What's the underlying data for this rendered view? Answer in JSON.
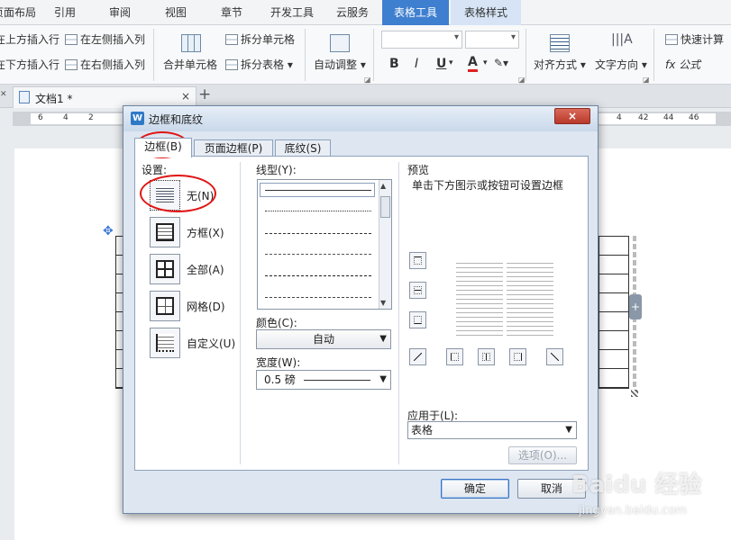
{
  "ribbon_tabs": [
    {
      "label": "页面布局"
    },
    {
      "label": "引用"
    },
    {
      "label": "审阅"
    },
    {
      "label": "视图"
    },
    {
      "label": "章节"
    },
    {
      "label": "开发工具"
    },
    {
      "label": "云服务"
    },
    {
      "label": "表格工具"
    },
    {
      "label": "表格样式"
    }
  ],
  "ribbon": {
    "insert_above": "在上方插入行",
    "insert_left": "在左侧插入列",
    "insert_below": "在下方插入行",
    "insert_right": "在右侧插入列",
    "merge_cells": "合并单元格",
    "split_cells": "拆分单元格",
    "split_table": "拆分表格",
    "auto_fit": "自动调整",
    "bold": "B",
    "italic": "I",
    "underline": "U",
    "font_color": "A",
    "align": "对齐方式",
    "text_direction": "文字方向",
    "quick_calc": "快速计算",
    "formula": "fx 公式"
  },
  "document_tab": {
    "label": "文档1 *",
    "new_tab": "+"
  },
  "ruler": {
    "left": [
      "6",
      "4",
      "2"
    ],
    "right": [
      "4",
      "42",
      "44",
      "46"
    ]
  },
  "dialog": {
    "title": "边框和底纹",
    "close": "×",
    "tabs": [
      {
        "label": "边框(B)"
      },
      {
        "label": "页面边框(P)"
      },
      {
        "label": "底纹(S)"
      }
    ],
    "setting_label": "设置:",
    "settings": [
      {
        "label": "无(N)"
      },
      {
        "label": "方框(X)"
      },
      {
        "label": "全部(A)"
      },
      {
        "label": "网格(D)"
      },
      {
        "label": "自定义(U)"
      }
    ],
    "line_style_label": "线型(Y):",
    "color_label": "颜色(C):",
    "color_value": "自动",
    "width_label": "宽度(W):",
    "width_value": "0.5 磅",
    "preview_label": "预览",
    "preview_hint": "单击下方图示或按钮可设置边框",
    "apply_to_label": "应用于(L):",
    "apply_to_value": "表格",
    "options_button": "选项(O)...",
    "ok": "确定",
    "cancel": "取消"
  },
  "watermark": {
    "brand": "Baidu 经验",
    "url": "jingyan.baidu.com"
  }
}
